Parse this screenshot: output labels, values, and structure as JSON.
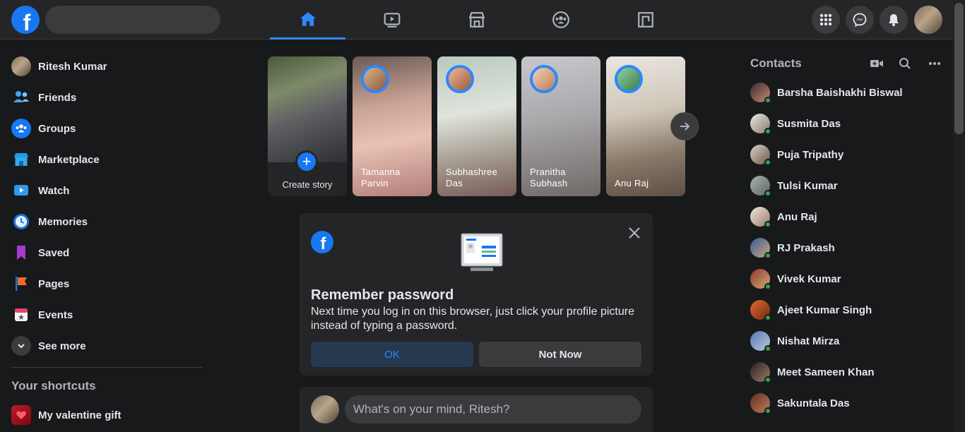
{
  "search": {
    "placeholder": ""
  },
  "user": {
    "name": "Ritesh Kumar"
  },
  "left_menu": [
    {
      "label": "Ritesh Kumar",
      "icon": "profile-avatar"
    },
    {
      "label": "Friends",
      "icon": "friends-icon"
    },
    {
      "label": "Groups",
      "icon": "groups-icon"
    },
    {
      "label": "Marketplace",
      "icon": "marketplace-icon"
    },
    {
      "label": "Watch",
      "icon": "watch-icon"
    },
    {
      "label": "Memories",
      "icon": "memories-icon"
    },
    {
      "label": "Saved",
      "icon": "saved-icon"
    },
    {
      "label": "Pages",
      "icon": "pages-icon"
    },
    {
      "label": "Events",
      "icon": "events-icon"
    },
    {
      "label": "See more",
      "icon": "chevron-down-icon"
    }
  ],
  "shortcuts": {
    "title": "Your shortcuts",
    "items": [
      {
        "label": "My valentine gift",
        "icon": "gift-icon"
      }
    ]
  },
  "stories": {
    "create_label": "Create story",
    "items": [
      {
        "name": "Tamanna Parvin"
      },
      {
        "name": "Subhashree Das"
      },
      {
        "name": "Pranitha Subhash"
      },
      {
        "name": "Anu Raj"
      }
    ]
  },
  "remember_card": {
    "title": "Remember password",
    "description": "Next time you log in on this browser, just click your profile picture instead of typing a password.",
    "ok_label": "OK",
    "not_now_label": "Not Now"
  },
  "composer": {
    "placeholder": "What's on your mind, Ritesh?"
  },
  "contacts": {
    "title": "Contacts",
    "items": [
      {
        "name": "Barsha Baishakhi Biswal"
      },
      {
        "name": "Susmita Das"
      },
      {
        "name": "Puja Tripathy"
      },
      {
        "name": "Tulsi Kumar"
      },
      {
        "name": "Anu Raj"
      },
      {
        "name": "RJ Prakash"
      },
      {
        "name": "Vivek Kumar"
      },
      {
        "name": "Ajeet Kumar Singh"
      },
      {
        "name": "Nishat Mirza"
      },
      {
        "name": "Meet Sameen Khan"
      },
      {
        "name": "Sakuntala Das"
      }
    ]
  },
  "colors": {
    "brand": "#1877f2",
    "accent": "#2d88ff",
    "online": "#31a24c",
    "background": "#18191a",
    "surface": "#242526"
  }
}
